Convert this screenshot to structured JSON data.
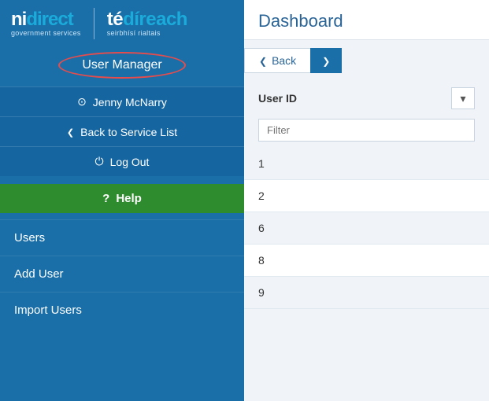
{
  "sidebar": {
    "logo": {
      "ni": "ni",
      "direct": "direct",
      "govt_label": "government services",
      "te": "té",
      "direach": "díreach",
      "seirbhisi_label": "seirbhísí rialtais"
    },
    "user_manager_label": "User Manager",
    "user_name": "Jenny McNarry",
    "back_label": "Back to Service List",
    "logout_label": "Log Out",
    "help_label": "Help",
    "menu_items": [
      {
        "label": "Users"
      },
      {
        "label": "Add User"
      },
      {
        "label": "Import Users"
      }
    ]
  },
  "main": {
    "title": "Dashboard",
    "back_button": "Back",
    "column_headers": [
      {
        "label": "User ID"
      }
    ],
    "filter_placeholder": "Filter",
    "rows": [
      {
        "user_id": "1"
      },
      {
        "user_id": "2"
      },
      {
        "user_id": "6"
      },
      {
        "user_id": "8"
      },
      {
        "user_id": "9"
      }
    ]
  }
}
